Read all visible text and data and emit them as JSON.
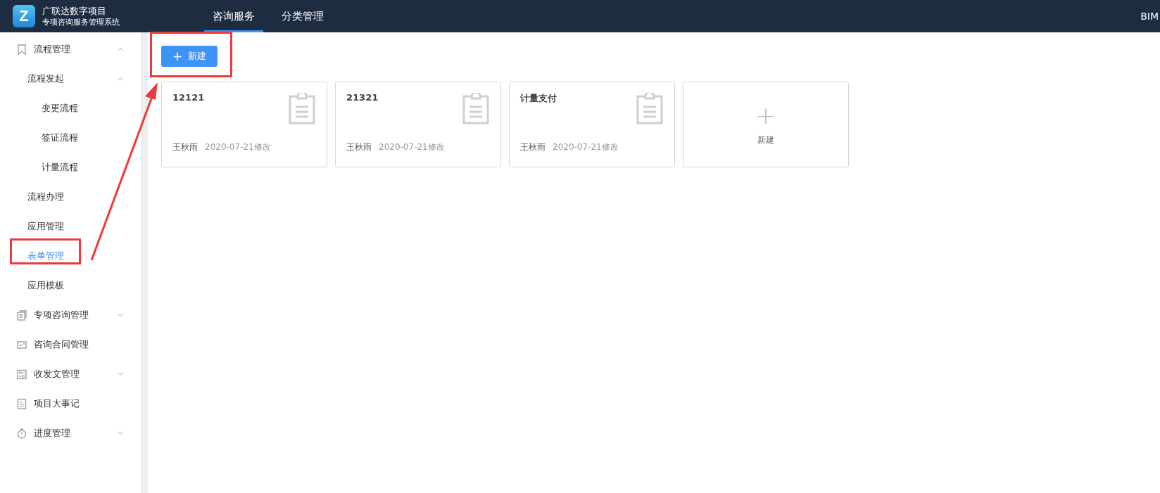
{
  "header": {
    "logo": {
      "letter": "Z"
    },
    "title": "广联达数字项目",
    "subtitle": "专项咨询服务管理系统",
    "tabs": [
      {
        "label": "咨询服务",
        "selected": true
      },
      {
        "label": "分类管理",
        "selected": false
      }
    ],
    "right_text": "BIM"
  },
  "sidebar": {
    "items": [
      {
        "label": "流程管理",
        "expanded": true,
        "selected": false,
        "children": [
          {
            "label": "流程发起",
            "expanded": true,
            "selected": false,
            "children": [
              {
                "label": "变更流程",
                "selected": false
              },
              {
                "label": "签证流程",
                "selected": false
              },
              {
                "label": "计量流程",
                "selected": false
              }
            ]
          },
          {
            "label": "流程办理",
            "selected": false
          },
          {
            "label": "应用管理",
            "selected": false
          },
          {
            "label": "表单管理",
            "selected": true
          },
          {
            "label": "应用模板",
            "selected": false
          }
        ]
      },
      {
        "label": "专项咨询管理",
        "expanded": false,
        "selected": false
      },
      {
        "label": "咨询合同管理",
        "selected": false
      },
      {
        "label": "收发文管理",
        "expanded": false,
        "selected": false
      },
      {
        "label": "项目大事记",
        "selected": false
      },
      {
        "label": "进度管理",
        "expanded": false,
        "selected": false
      }
    ]
  },
  "toolbar": {
    "new_button": {
      "icon": "+",
      "label": "新建"
    }
  },
  "cards": [
    {
      "kind": "form",
      "title": "12121",
      "author": "王秋雨",
      "modified": "2020-07-21修改"
    },
    {
      "kind": "form",
      "title": "21321",
      "author": "王秋雨",
      "modified": "2020-07-21修改"
    },
    {
      "kind": "form",
      "title": "计量支付",
      "author": "王秋雨",
      "modified": "2020-07-21修改"
    },
    {
      "kind": "add",
      "icon": "+",
      "label": "新建"
    }
  ]
}
